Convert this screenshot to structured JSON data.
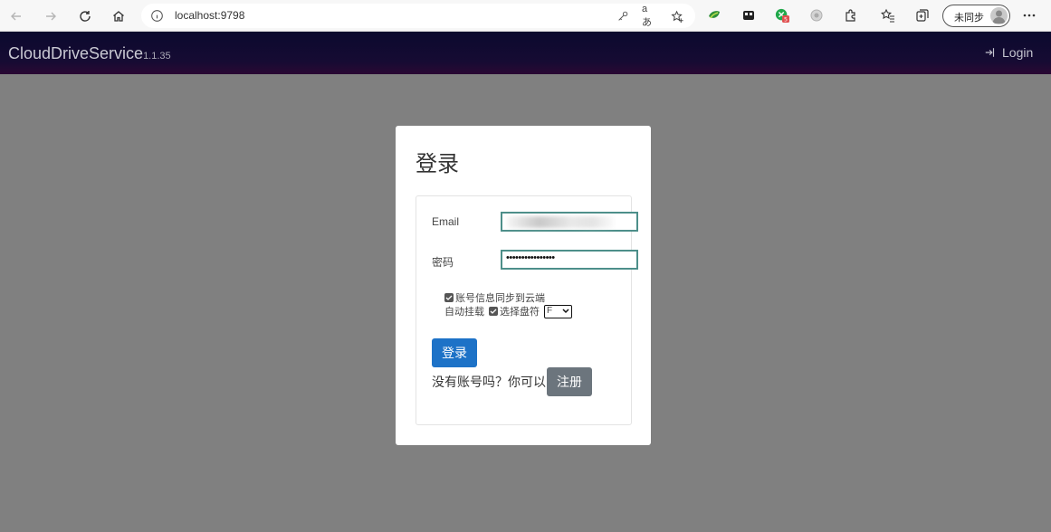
{
  "browser": {
    "url": "localhost:9798",
    "read_aloud": "aあ",
    "sync_label": "未同步",
    "ext_badge": "5"
  },
  "navbar": {
    "brand": "CloudDriveService",
    "version": "1.1.35",
    "login_label": "Login"
  },
  "login_card": {
    "title": "登录",
    "email_label": "Email",
    "password_label": "密码",
    "password_value": "••••••••••••••••",
    "sync_option_label": "账号信息同步到云端",
    "auto_mount_label": "自动挂载",
    "select_drive_label": "选择盘符",
    "drive_letter": "F",
    "login_button": "登录",
    "register_prompt": "没有账号吗？你可以",
    "register_button": "注册"
  },
  "colors": {
    "primary": "#1d72c7",
    "secondary": "#6c757d",
    "navbar": "#0b0a2e",
    "backdrop": "#808080"
  }
}
